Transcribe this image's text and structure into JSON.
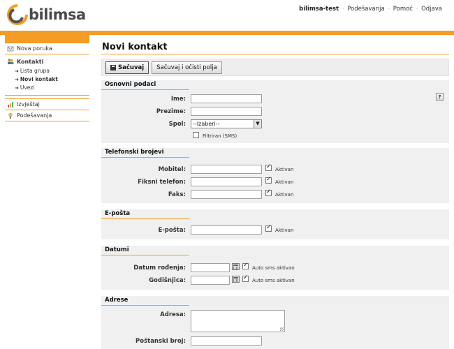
{
  "header": {
    "logo_text": "bilimsa",
    "username": "bilimsa-test",
    "nav_sep": "·",
    "nav": [
      "Podešavanja",
      "Pomoć",
      "Odjava"
    ]
  },
  "sidebar": {
    "items": [
      {
        "label": "Nova poruka",
        "icon": "new-message-icon"
      },
      {
        "label": "Kontakti",
        "icon": "contacts-icon"
      },
      {
        "label": "Izvještaj",
        "icon": "report-icon"
      },
      {
        "label": "Podešavanja",
        "icon": "settings-icon"
      }
    ],
    "contacts_sub": [
      "Lista grupa",
      "Novi kontakt",
      "Uvezi"
    ],
    "sub_arrow": "➜"
  },
  "main": {
    "title": "Novi kontakt",
    "toolbar": {
      "save": "Sačuvaj",
      "save_clear": "Sačuvaj i očisti polja"
    },
    "help": "?",
    "basic": {
      "title": "Osnovni podaci",
      "first_name": "Ime:",
      "last_name": "Prezime:",
      "gender": "Spol:",
      "gender_value": "--Izaberi--",
      "filtered": "Filtriran (SMS)"
    },
    "phones": {
      "title": "Telefonski brojevi",
      "mobile": "Mobitel:",
      "landline": "Fiksni telefon:",
      "fax": "Faks:",
      "active": "Aktivan"
    },
    "email": {
      "title": "E-pošta",
      "email": "E-pošta:",
      "active": "Aktivan"
    },
    "dates": {
      "title": "Datumi",
      "birthday": "Datum rođenja:",
      "anniversary": "Godišnjica:",
      "auto_sms": "Auto sms aktivan"
    },
    "addresses": {
      "title": "Adrese",
      "address": "Adresa:",
      "postal_code": "Poštanski broj:"
    }
  },
  "colors": {
    "accent": "#f39c26",
    "panel": "#f0f0f0"
  }
}
